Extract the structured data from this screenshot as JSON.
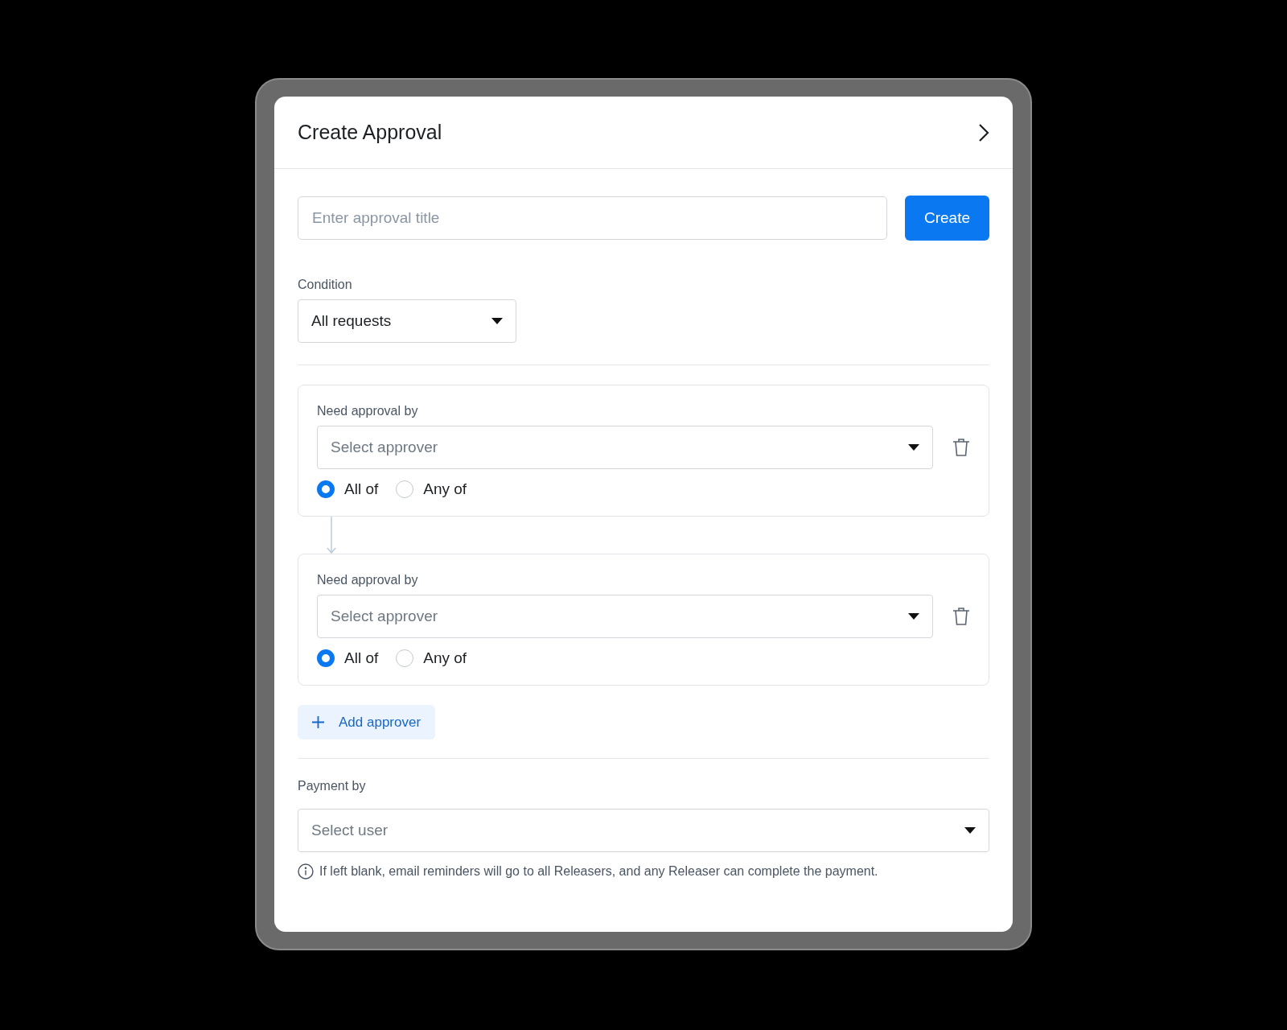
{
  "panel": {
    "title": "Create Approval"
  },
  "title_field": {
    "placeholder": "Enter approval title"
  },
  "create_button": "Create",
  "condition": {
    "label": "Condition",
    "value": "All requests"
  },
  "approval_steps": [
    {
      "label": "Need approval by",
      "placeholder": "Select approver",
      "options": [
        {
          "label": "All of",
          "selected": true
        },
        {
          "label": "Any of",
          "selected": false
        }
      ]
    },
    {
      "label": "Need approval by",
      "placeholder": "Select approver",
      "options": [
        {
          "label": "All of",
          "selected": true
        },
        {
          "label": "Any of",
          "selected": false
        }
      ]
    }
  ],
  "add_button": "Add approver",
  "payment": {
    "label": "Payment by",
    "placeholder": "Select user",
    "note": "If left blank, email reminders will go to all Releasers, and any Releaser can complete the payment."
  }
}
